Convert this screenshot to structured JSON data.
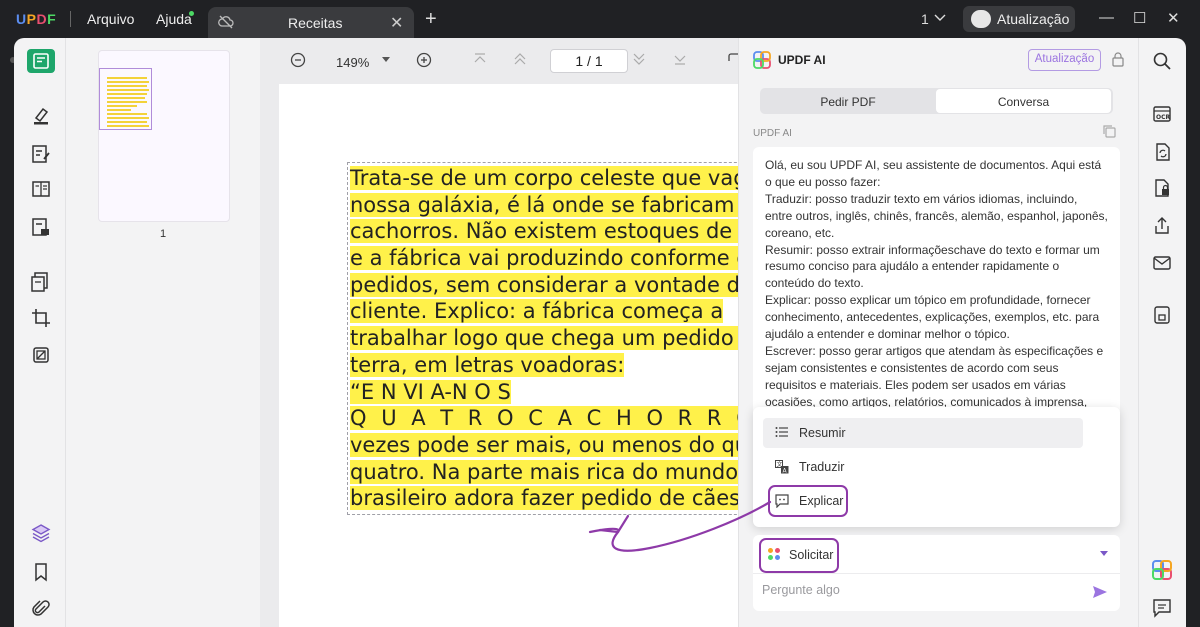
{
  "app": {
    "logo": "UPDF",
    "menu": [
      "Arquivo",
      "Ajuda"
    ],
    "tab_title": "Receitas",
    "page_count_label": "1",
    "upgrade_label": "Atualização"
  },
  "viewer": {
    "zoom": "149%",
    "page_indicator": "1  /  1",
    "thumbnail_page_number": "1"
  },
  "document_lines": [
    "Trata-se de um corpo celeste que vaga",
    "nossa galáxia, é lá onde se fabricam os",
    "cachorros. Não existem estoques de ar",
    "e a fábrica vai produzindo conforme os",
    "pedidos, sem considerar a vontade do",
    "cliente. Explico: a fábrica começa a",
    "trabalhar logo que chega um pedido d",
    "terra, em letras voadoras:",
    "“E N VI A-N O S",
    "Q U A T R O C A C H O R R O S”. Às",
    "vezes pode ser mais, ou menos do que",
    "quatro. Na parte mais rica do mundo p",
    "brasileiro adora fazer pedido de cães."
  ],
  "ai_panel": {
    "title": "UPDF AI",
    "upgrade_button": "Atualização",
    "tabs": [
      "Pedir PDF",
      "Conversa"
    ],
    "active_tab": "Conversa",
    "sender": "UPDF AI",
    "message_lines": [
      "Olá, eu sou UPDF AI, seu assistente de documentos. Aqui está o que eu posso fazer:",
      "Traduzir: posso traduzir texto em vários idiomas, incluindo, entre outros, inglês, chinês, francês, alemão, espanhol, japonês, coreano, etc.",
      "Resumir: posso extrair informaçõeschave do texto e formar um resumo conciso para ajudálo a entender rapidamente o conteúdo do texto.",
      "Explicar: posso explicar um tópico em profundidade, fornecer conhecimento, antecedentes, explicações, exemplos, etc. para ajudálo a entender e dominar melhor o tópico.",
      "Escrever: posso gerar artigos que atendam às especificações e sejam consistentes e consistentes de acordo com seus requisitos e materiais. Eles podem ser usados em várias ocasiões, como artigos, relatórios, comunicados à imprensa,"
    ],
    "actions": [
      {
        "label": "Resumir",
        "icon": "list-icon"
      },
      {
        "label": "Traduzir",
        "icon": "translate-icon"
      },
      {
        "label": "Explicar",
        "icon": "explain-icon"
      }
    ],
    "prompt_mode": "Solicitar",
    "input_placeholder": "Pergunte algo"
  },
  "colors": {
    "accent_green": "#1ea66b",
    "highlight_yellow": "#fff14a",
    "ai_purple": "#9b74e0",
    "annotation_purple": "#8e3aa8"
  }
}
